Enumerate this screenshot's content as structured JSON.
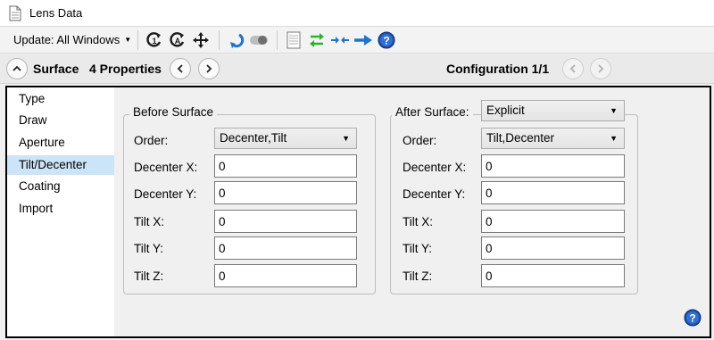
{
  "window": {
    "title": "Lens Data"
  },
  "toolbar": {
    "update_label": "Update: All Windows",
    "icons": [
      "refresh-icon",
      "auto-refresh-icon",
      "move-icon",
      "undo-icon",
      "toggle-icon",
      "sheet-icon",
      "swap-icon",
      "arrows-in-icon",
      "arrow-right-icon",
      "help-icon"
    ]
  },
  "surface_bar": {
    "title": "Surface",
    "properties_label": "4 Properties",
    "configuration_label": "Configuration 1/1"
  },
  "sidebar": {
    "items": [
      {
        "label": "Type"
      },
      {
        "label": "Draw"
      },
      {
        "label": "Aperture"
      },
      {
        "label": "Tilt/Decenter",
        "active": true
      },
      {
        "label": "Coating"
      },
      {
        "label": "Import"
      }
    ]
  },
  "before_surface": {
    "title": "Before Surface",
    "order_label": "Order:",
    "order_value": "Decenter,Tilt",
    "decenter_x_label": "Decenter X:",
    "decenter_x": "0",
    "decenter_y_label": "Decenter Y:",
    "decenter_y": "0",
    "tilt_x_label": "Tilt X:",
    "tilt_x": "0",
    "tilt_y_label": "Tilt Y:",
    "tilt_y": "0",
    "tilt_z_label": "Tilt Z:",
    "tilt_z": "0"
  },
  "after_surface": {
    "title": "After Surface:",
    "mode_value": "Explicit",
    "order_label": "Order:",
    "order_value": "Tilt,Decenter",
    "decenter_x_label": "Decenter X:",
    "decenter_x": "0",
    "decenter_y_label": "Decenter Y:",
    "decenter_y": "0",
    "tilt_x_label": "Tilt X:",
    "tilt_x": "0",
    "tilt_y_label": "Tilt Y:",
    "tilt_y": "0",
    "tilt_z_label": "Tilt Z:",
    "tilt_z": "0"
  },
  "colors": {
    "accent_blue": "#1e73d2",
    "active_row": "#cce4f7",
    "green": "#2db22d"
  }
}
